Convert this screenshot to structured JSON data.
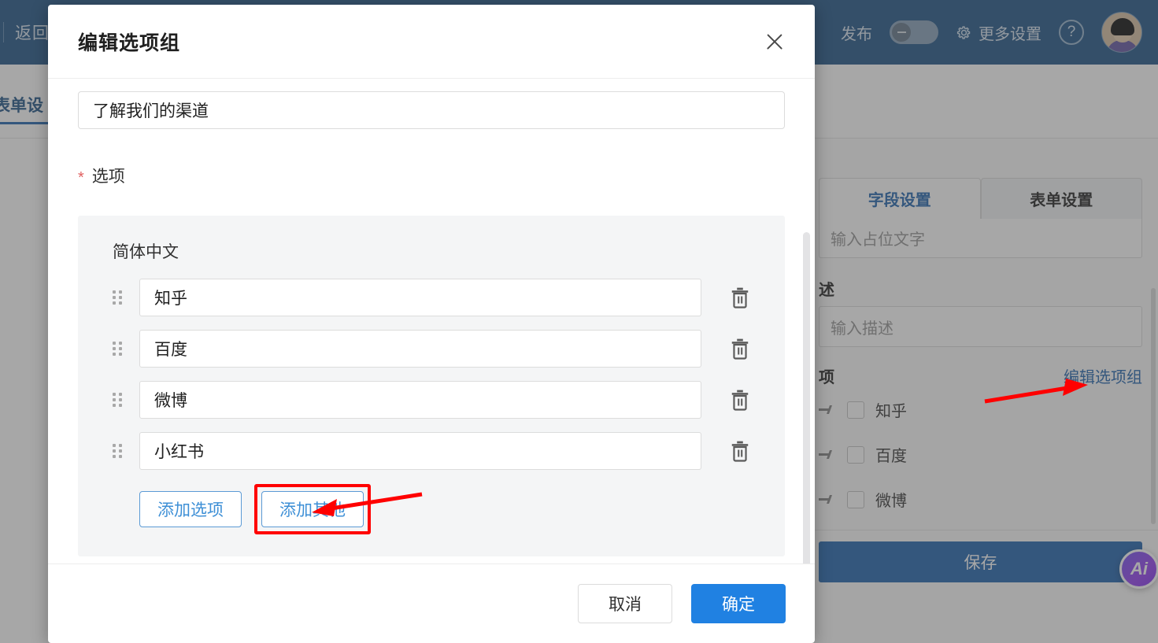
{
  "topbar": {
    "back_label": "返回",
    "publish_label": "发布",
    "publish_toggle_state": "off",
    "more_settings_label": "更多设置",
    "help_label": "?",
    "gear_icon": "gear-icon",
    "avatar_icon": "user-avatar"
  },
  "background": {
    "subtab_label": "表单设",
    "panel": {
      "tabs": [
        {
          "label": "字段设置",
          "active": true
        },
        {
          "label": "表单设置",
          "active": false
        }
      ],
      "placeholder_field_value": "输入占位文字",
      "description_label": "述",
      "description_placeholder": "输入描述",
      "options_label": "项",
      "edit_option_group_link": "编辑选项组",
      "option_items": [
        {
          "label": "知乎",
          "checked": false
        },
        {
          "label": "百度",
          "checked": false
        },
        {
          "label": "微博",
          "checked": false
        }
      ],
      "save_label": "保存"
    }
  },
  "modal": {
    "title": "编辑选项组",
    "close_icon": "close-icon",
    "group_name_value": "了解我们的渠道",
    "options_required_mark": "*",
    "options_label": "选项",
    "language_label": "简体中文",
    "options": [
      {
        "value": "知乎"
      },
      {
        "value": "百度"
      },
      {
        "value": "微博"
      },
      {
        "value": "小红书"
      }
    ],
    "add_option_label": "添加选项",
    "add_other_label": "添加其他",
    "cancel_label": "取消",
    "confirm_label": "确定"
  },
  "ai_fab": {
    "label": "Ai"
  },
  "colors": {
    "topbar_blue": "#2f5f8f",
    "primary_blue": "#2081e2",
    "link_blue": "#2f6db3",
    "highlight_red": "#ff0000",
    "required_red": "#e06060",
    "panel_gray": "#f4f5f6"
  }
}
